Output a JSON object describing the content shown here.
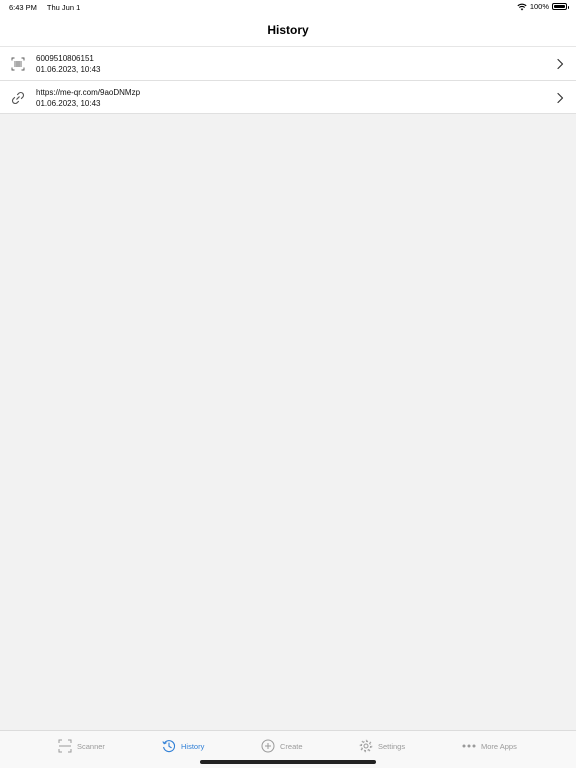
{
  "status_bar": {
    "time": "6:43 PM",
    "date": "Thu Jun 1",
    "battery": "100%"
  },
  "nav": {
    "title": "History"
  },
  "history": [
    {
      "icon": "barcode-icon",
      "value": "6009510806151",
      "timestamp": "01.06.2023, 10:43"
    },
    {
      "icon": "link-icon",
      "value": "https://me-qr.com/9aoDNMzp",
      "timestamp": "01.06.2023, 10:43"
    }
  ],
  "tabs": [
    {
      "label": "Scanner",
      "icon": "scanner-icon",
      "active": false
    },
    {
      "label": "History",
      "icon": "history-icon",
      "active": true
    },
    {
      "label": "Create",
      "icon": "plus-circle-icon",
      "active": false
    },
    {
      "label": "Settings",
      "icon": "gear-icon",
      "active": false
    },
    {
      "label": "More Apps",
      "icon": "ellipsis-icon",
      "active": false
    }
  ],
  "colors": {
    "accent": "#2f7fd6",
    "inactive": "#9a9a9a",
    "background": "#f2f2f2"
  }
}
